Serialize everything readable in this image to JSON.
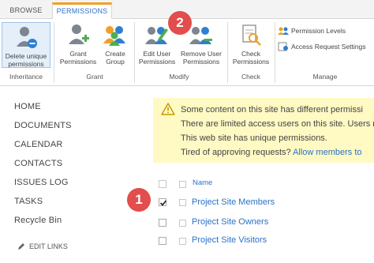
{
  "tabs": {
    "browse": "BROWSE",
    "permissions": "PERMISSIONS"
  },
  "ribbon": {
    "delete_unique": [
      "Delete unique",
      "permissions"
    ],
    "grant_permissions": [
      "Grant",
      "Permissions"
    ],
    "create_group": [
      "Create",
      "Group"
    ],
    "edit_user_permissions": [
      "Edit User",
      "Permissions"
    ],
    "remove_user_permissions": [
      "Remove User",
      "Permissions"
    ],
    "check_permissions": [
      "Check",
      "Permissions"
    ],
    "permission_levels": "Permission Levels",
    "access_request_settings": "Access Request Settings",
    "groups": {
      "inheritance": "Inheritance",
      "grant": "Grant",
      "modify": "Modify",
      "check": "Check",
      "manage": "Manage"
    }
  },
  "nav": {
    "items": [
      "HOME",
      "DOCUMENTS",
      "CALENDAR",
      "CONTACTS",
      "ISSUES LOG",
      "TASKS",
      "Recycle Bin"
    ],
    "edit_links": "EDIT LINKS"
  },
  "banner": {
    "line1": "Some content on this site has different permissi",
    "line2": "There are limited access users on this site. Users may",
    "line3": "This web site has unique permissions.",
    "line4_prefix": "Tired of approving requests? ",
    "line4_link": "Allow members to"
  },
  "list": {
    "header": "Name",
    "rows": [
      {
        "name": "Project Site Members",
        "checked": true
      },
      {
        "name": "Project Site Owners",
        "checked": false
      },
      {
        "name": "Project Site Visitors",
        "checked": false
      }
    ]
  },
  "callouts": [
    "1",
    "2"
  ],
  "colors": {
    "accent_tab": "#f0a028",
    "link": "#2a72c7",
    "banner_bg": "#fff9c4",
    "callout": "#e24d4d"
  }
}
